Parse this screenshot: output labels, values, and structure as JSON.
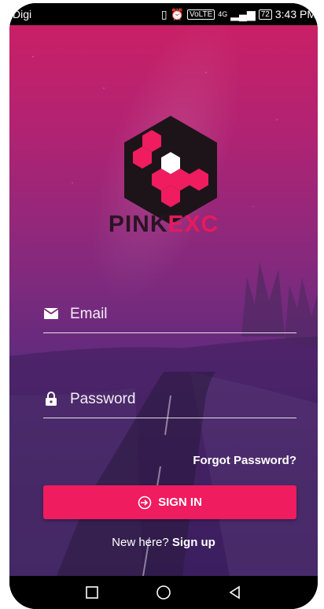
{
  "status_bar": {
    "carrier": "Digi",
    "network_tag": "VoLTE",
    "network_type": "4G",
    "battery": "72",
    "time": "3:43 PM"
  },
  "brand": {
    "part1": "PINK",
    "part2": "EXC"
  },
  "form": {
    "email_placeholder": "Email",
    "password_placeholder": "Password",
    "forgot_password": "Forgot Password?",
    "signin_label": "SIGN IN",
    "new_here": "New here?",
    "signup_link": "Sign up"
  },
  "icons": {
    "email": "mail-icon",
    "password": "lock-icon",
    "signin": "login-arrow-icon",
    "nav": [
      "recents-square-icon",
      "home-circle-icon",
      "back-triangle-icon"
    ]
  },
  "colors": {
    "accent": "#ef1c5f",
    "brand_dark": "#2a1424",
    "brand_pink": "#e51a5c"
  }
}
